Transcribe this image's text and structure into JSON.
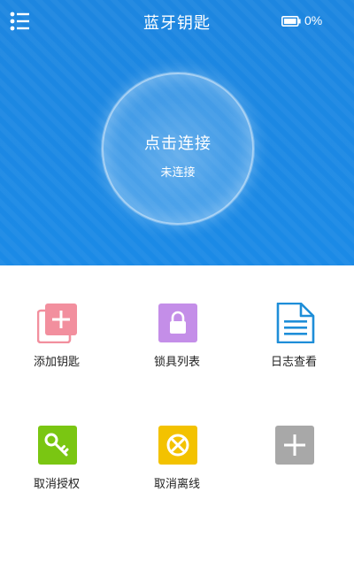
{
  "header": {
    "title": "蓝牙钥匙",
    "battery_text": "0%",
    "menu_icon": "menu-list-icon",
    "battery_icon": "battery-icon"
  },
  "connect": {
    "action_label": "点击连接",
    "status_text": "未连接"
  },
  "grid": {
    "items": [
      {
        "label": "添加钥匙",
        "icon": "add-key-icon",
        "color": "#f28f9e"
      },
      {
        "label": "锁具列表",
        "icon": "lock-icon",
        "color": "#c48ee8"
      },
      {
        "label": "日志查看",
        "icon": "document-icon",
        "color": "#1e8ed8"
      },
      {
        "label": "取消授权",
        "icon": "key-icon",
        "color": "#7ac612"
      },
      {
        "label": "取消离线",
        "icon": "cancel-circle-icon",
        "color": "#f3c200"
      },
      {
        "label": "",
        "icon": "plus-icon",
        "color": "#a8a8a8"
      }
    ]
  },
  "colors": {
    "header_blue": "#1b87e2",
    "text_dark": "#222222"
  }
}
